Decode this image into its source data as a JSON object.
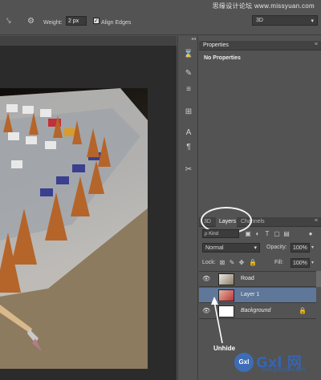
{
  "watermark": "思缘设计论坛 www.missyuan.com",
  "options_bar": {
    "weight_label": "Weight:",
    "weight_value": "2 px",
    "align_edges_label": "Align Edges",
    "workspace_value": "3D"
  },
  "properties_panel": {
    "tab_label": "Properties",
    "message": "No Properties"
  },
  "layers_panel": {
    "tabs": [
      "3D",
      "Layers",
      "Channels"
    ],
    "active_tab": "Layers",
    "kind_filter": "ρ Kind",
    "blend_mode": "Normal",
    "opacity_label": "Opacity:",
    "opacity_value": "100%",
    "lock_label": "Lock:",
    "fill_label": "Fill:",
    "fill_value": "100%",
    "layers": [
      {
        "name": "Road",
        "selected": false,
        "visible": true
      },
      {
        "name": "Layer 1",
        "selected": true,
        "visible": false
      },
      {
        "name": "Background",
        "selected": false,
        "visible": true,
        "locked": true
      }
    ]
  },
  "annotation": {
    "label": "Unhide"
  },
  "logo": {
    "badge": "Gxl",
    "name": "Gxl 网",
    "url": "www.gxlsystem.com"
  },
  "colors": {
    "panel_bg": "#535353",
    "selected_layer": "#5f7799",
    "logo_blue": "#3565b3"
  }
}
